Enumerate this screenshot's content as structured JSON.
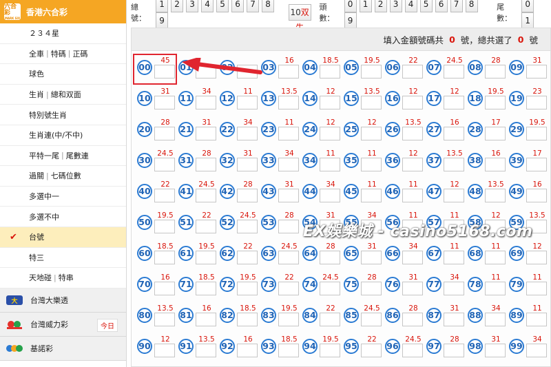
{
  "sidebar": {
    "header": {
      "title": "香港六合彩",
      "logo_text": "六合彩",
      "logo_sub": "MARK SIX"
    },
    "items": [
      {
        "parts": [
          "２３４星"
        ]
      },
      {
        "parts": [
          "全車",
          "特碼",
          "正碼"
        ]
      },
      {
        "parts": [
          "球色"
        ]
      },
      {
        "parts": [
          "生肖",
          "總和双面"
        ]
      },
      {
        "parts": [
          "特別號生肖"
        ]
      },
      {
        "parts": [
          "生肖連(中/不中)"
        ]
      },
      {
        "parts": [
          "平特一尾",
          "尾數連"
        ]
      },
      {
        "parts": [
          "過關",
          "七碼位數"
        ]
      },
      {
        "parts": [
          "多選中一"
        ]
      },
      {
        "parts": [
          "多選不中"
        ]
      },
      {
        "parts": [
          "台號"
        ],
        "active": true
      },
      {
        "parts": [
          "特三"
        ]
      },
      {
        "parts": [
          "天地碰",
          "特串"
        ]
      }
    ],
    "check_mark": "✔",
    "games": [
      {
        "label": "台灣大樂透",
        "icon": "lotto-icon"
      },
      {
        "label": "台灣威力彩",
        "icon": "power-lottery-icon",
        "badge": "今日"
      },
      {
        "label": "基諾彩",
        "icon": "keno-icon"
      }
    ]
  },
  "topbar": {
    "total_label": "總號：",
    "total_buttons": [
      "1",
      "2",
      "3",
      "4",
      "5",
      "6",
      "7",
      "8",
      "9"
    ],
    "total_special": {
      "num": "10",
      "text": "双生"
    },
    "head_label": "頭數：",
    "head_buttons": [
      "0",
      "1",
      "2",
      "3",
      "4",
      "5",
      "6",
      "7",
      "8",
      "9"
    ],
    "tail_label": "尾數：",
    "tail_buttons": [
      "0",
      "1"
    ]
  },
  "info": {
    "prefix": "填入金額號碼共",
    "count1": "0",
    "middle": "號，總共選了",
    "count2": "0",
    "suffix": "號"
  },
  "grid": {
    "cells": [
      {
        "n": "00",
        "o": "45"
      },
      {
        "n": "01",
        "o": ""
      },
      {
        "n": "02",
        "o": ""
      },
      {
        "n": "03",
        "o": "16"
      },
      {
        "n": "04",
        "o": "18.5"
      },
      {
        "n": "05",
        "o": "19.5"
      },
      {
        "n": "06",
        "o": "22"
      },
      {
        "n": "07",
        "o": "24.5"
      },
      {
        "n": "08",
        "o": "28"
      },
      {
        "n": "09",
        "o": "31"
      },
      {
        "n": "10",
        "o": "31"
      },
      {
        "n": "11",
        "o": "34"
      },
      {
        "n": "12",
        "o": "11"
      },
      {
        "n": "13",
        "o": "13.5"
      },
      {
        "n": "14",
        "o": "12"
      },
      {
        "n": "15",
        "o": "13.5"
      },
      {
        "n": "16",
        "o": "12"
      },
      {
        "n": "17",
        "o": "12"
      },
      {
        "n": "18",
        "o": "19.5"
      },
      {
        "n": "19",
        "o": "23"
      },
      {
        "n": "20",
        "o": "28"
      },
      {
        "n": "21",
        "o": "31"
      },
      {
        "n": "22",
        "o": "34"
      },
      {
        "n": "23",
        "o": "11"
      },
      {
        "n": "24",
        "o": "12"
      },
      {
        "n": "25",
        "o": "12"
      },
      {
        "n": "26",
        "o": "13.5"
      },
      {
        "n": "27",
        "o": "16"
      },
      {
        "n": "28",
        "o": "17"
      },
      {
        "n": "29",
        "o": "19.5"
      },
      {
        "n": "30",
        "o": "24.5"
      },
      {
        "n": "31",
        "o": "28"
      },
      {
        "n": "32",
        "o": "31"
      },
      {
        "n": "33",
        "o": "34"
      },
      {
        "n": "34",
        "o": "11"
      },
      {
        "n": "35",
        "o": "11"
      },
      {
        "n": "36",
        "o": "12"
      },
      {
        "n": "37",
        "o": "13.5"
      },
      {
        "n": "38",
        "o": "16"
      },
      {
        "n": "39",
        "o": "17"
      },
      {
        "n": "40",
        "o": "22"
      },
      {
        "n": "41",
        "o": "24.5"
      },
      {
        "n": "42",
        "o": "28"
      },
      {
        "n": "43",
        "o": "31"
      },
      {
        "n": "44",
        "o": "34"
      },
      {
        "n": "45",
        "o": "11"
      },
      {
        "n": "46",
        "o": "11"
      },
      {
        "n": "47",
        "o": "12"
      },
      {
        "n": "48",
        "o": "13.5"
      },
      {
        "n": "49",
        "o": "16"
      },
      {
        "n": "50",
        "o": "19.5"
      },
      {
        "n": "51",
        "o": "22"
      },
      {
        "n": "52",
        "o": "24.5"
      },
      {
        "n": "53",
        "o": "28"
      },
      {
        "n": "54",
        "o": "31"
      },
      {
        "n": "55",
        "o": "34"
      },
      {
        "n": "56",
        "o": "11"
      },
      {
        "n": "57",
        "o": "11"
      },
      {
        "n": "58",
        "o": "12"
      },
      {
        "n": "59",
        "o": "13.5"
      },
      {
        "n": "60",
        "o": "18.5"
      },
      {
        "n": "61",
        "o": "19.5"
      },
      {
        "n": "62",
        "o": "22"
      },
      {
        "n": "63",
        "o": "24.5"
      },
      {
        "n": "64",
        "o": "28"
      },
      {
        "n": "65",
        "o": "31"
      },
      {
        "n": "66",
        "o": "34"
      },
      {
        "n": "67",
        "o": "11"
      },
      {
        "n": "68",
        "o": "11"
      },
      {
        "n": "69",
        "o": "12"
      },
      {
        "n": "70",
        "o": "16"
      },
      {
        "n": "71",
        "o": "18.5"
      },
      {
        "n": "72",
        "o": "19.5"
      },
      {
        "n": "73",
        "o": "22"
      },
      {
        "n": "74",
        "o": "24.5"
      },
      {
        "n": "75",
        "o": "28"
      },
      {
        "n": "76",
        "o": "31"
      },
      {
        "n": "77",
        "o": "34"
      },
      {
        "n": "78",
        "o": "11"
      },
      {
        "n": "79",
        "o": "11"
      },
      {
        "n": "80",
        "o": "13.5"
      },
      {
        "n": "81",
        "o": "16"
      },
      {
        "n": "82",
        "o": "18.5"
      },
      {
        "n": "83",
        "o": "19.5"
      },
      {
        "n": "84",
        "o": "22"
      },
      {
        "n": "85",
        "o": "24.5"
      },
      {
        "n": "86",
        "o": "28"
      },
      {
        "n": "87",
        "o": "31"
      },
      {
        "n": "88",
        "o": "34"
      },
      {
        "n": "89",
        "o": "11"
      },
      {
        "n": "90",
        "o": "12"
      },
      {
        "n": "91",
        "o": "13.5"
      },
      {
        "n": "92",
        "o": "16"
      },
      {
        "n": "93",
        "o": "18.5"
      },
      {
        "n": "94",
        "o": "19.5"
      },
      {
        "n": "95",
        "o": "22"
      },
      {
        "n": "96",
        "o": "24.5"
      },
      {
        "n": "97",
        "o": "28"
      },
      {
        "n": "98",
        "o": "31"
      },
      {
        "n": "99",
        "o": "34"
      }
    ]
  },
  "watermark": "EX娛樂城 - casino5168.com",
  "colors": {
    "accent": "#f5a623",
    "odds": "#d9150b",
    "ball": "#2b7bd3",
    "highlight": "#e0252f"
  }
}
